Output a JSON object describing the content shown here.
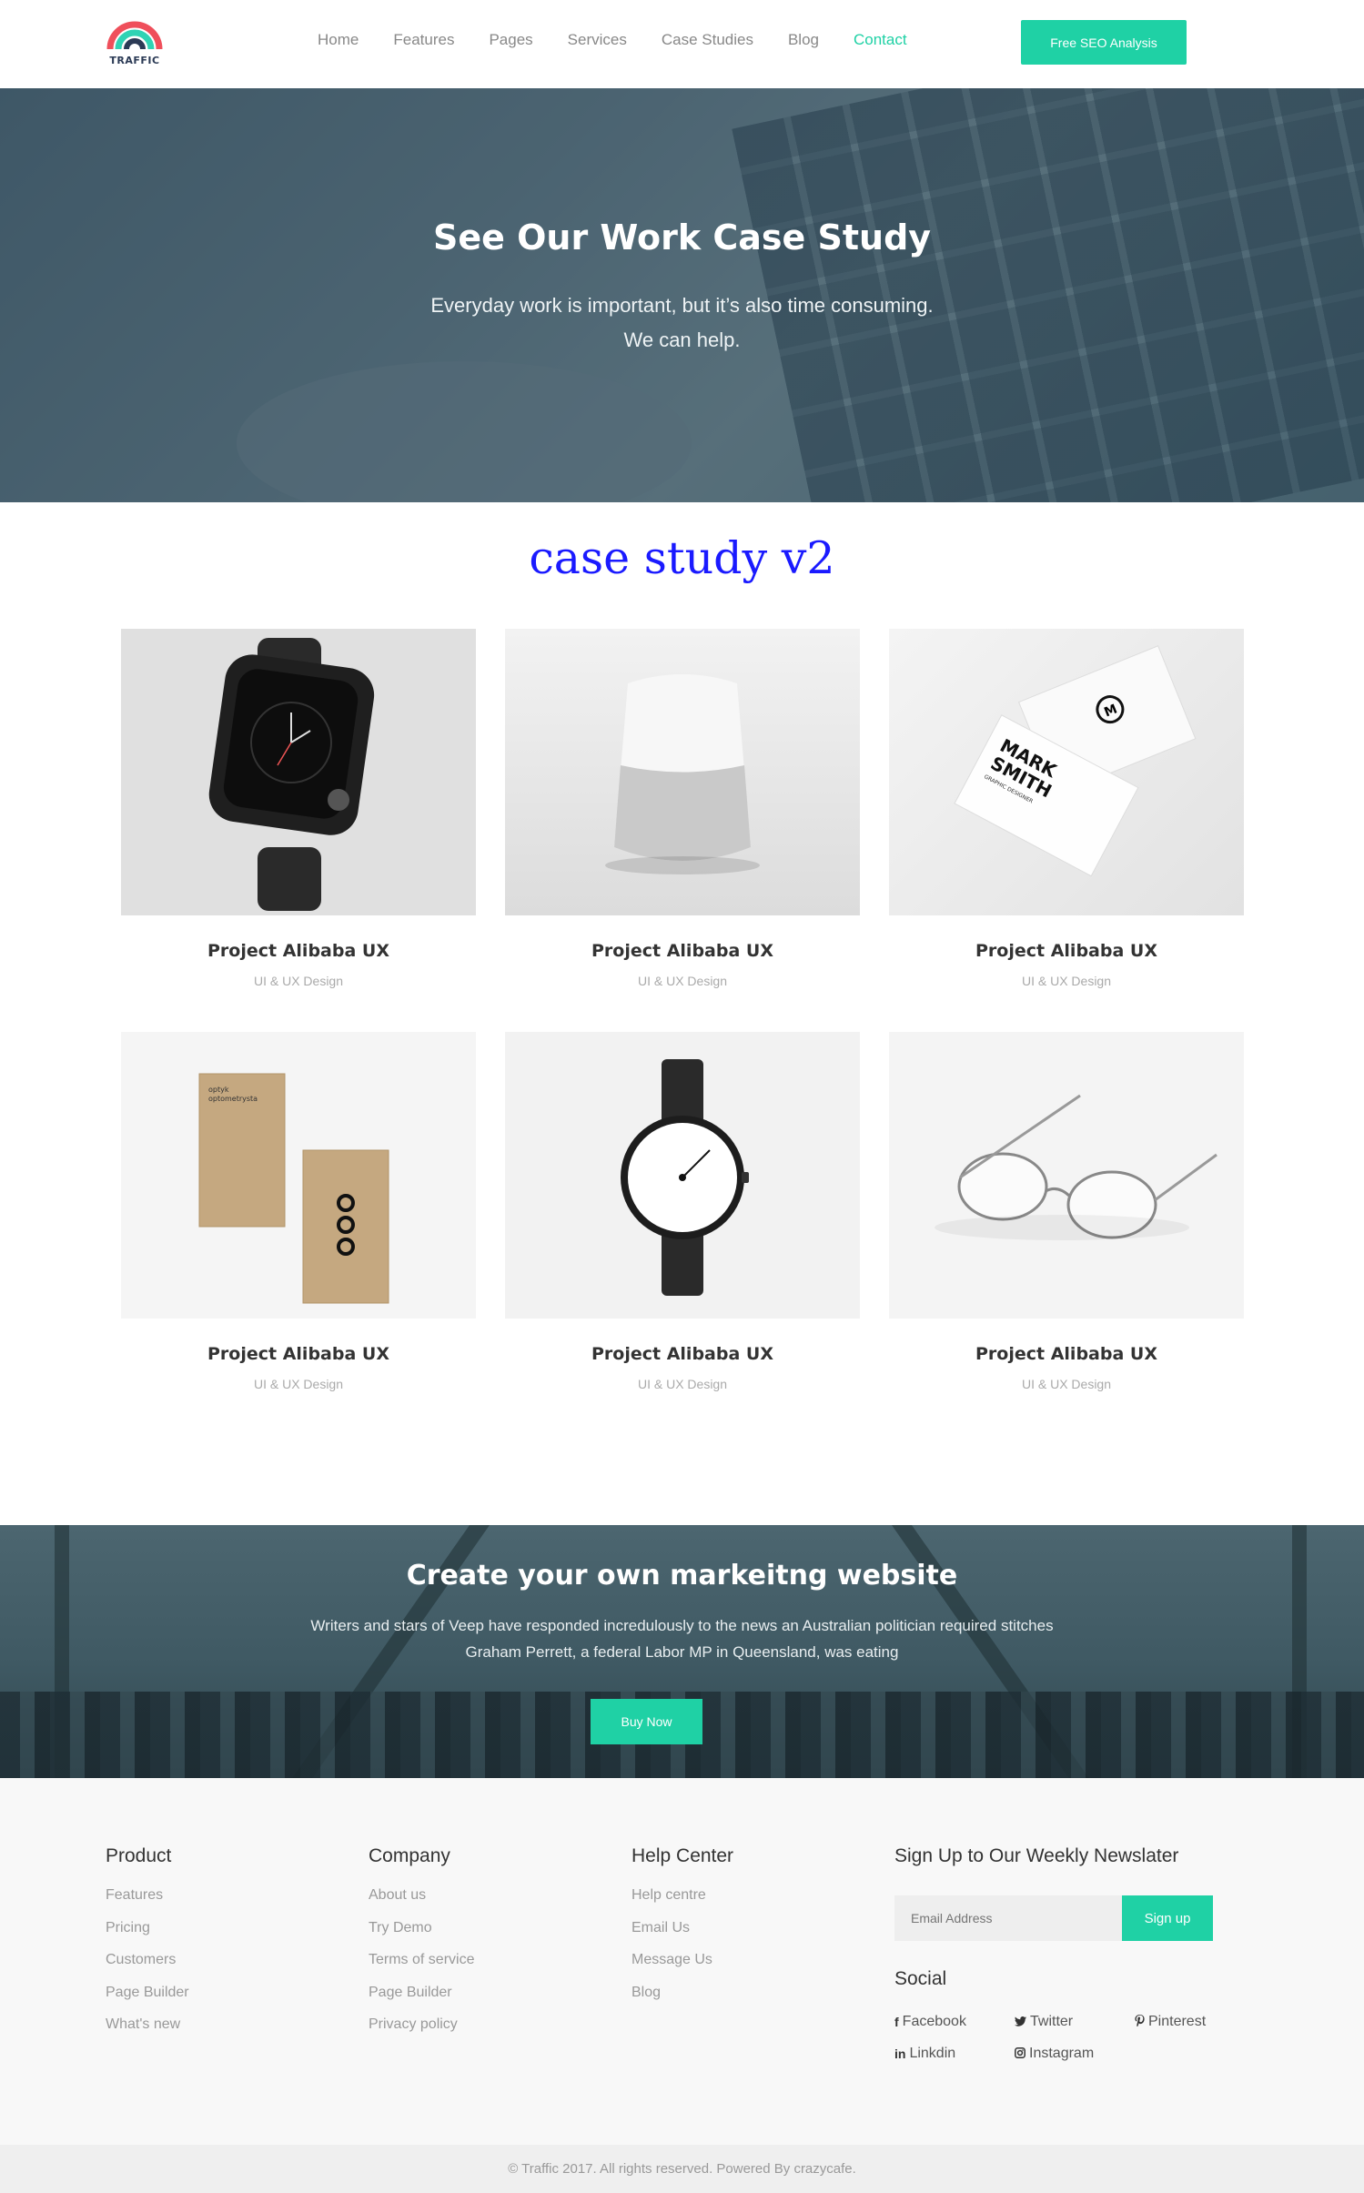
{
  "brand": {
    "name": "TRAFFIC",
    "colors": {
      "accent": "#1fd1a5",
      "logo_red": "#ef4f5b",
      "logo_teal": "#2fd3b4",
      "logo_navy": "#2b3a55"
    }
  },
  "nav": {
    "items": [
      {
        "label": "Home"
      },
      {
        "label": "Features"
      },
      {
        "label": "Pages"
      },
      {
        "label": "Services"
      },
      {
        "label": "Case Studies"
      },
      {
        "label": "Blog"
      },
      {
        "label": "Contact",
        "active": true
      }
    ],
    "cta_label": "Free SEO Analysis"
  },
  "hero": {
    "title": "See Our Work Case Study",
    "line1": "Everyday work is important, but it’s also time consuming.",
    "line2": "We can help."
  },
  "section_title": "case study v2",
  "projects": [
    {
      "title": "Project Alibaba UX",
      "category": "UI & UX Design",
      "icon": "smartwatch-image"
    },
    {
      "title": "Project Alibaba UX",
      "category": "UI & UX Design",
      "icon": "smart-speaker-image"
    },
    {
      "title": "Project Alibaba UX",
      "category": "UI & UX Design",
      "icon": "business-card-image",
      "card_text": {
        "monogram": "M",
        "name_line1": "MARK",
        "name_line2": "SMITH",
        "role": "GRAPHIC DESIGNER"
      }
    },
    {
      "title": "Project Alibaba UX",
      "category": "UI & UX Design",
      "icon": "kraft-card-image",
      "card_text": {
        "line1": "optyk",
        "line2": "optometrysta"
      }
    },
    {
      "title": "Project Alibaba UX",
      "category": "UI & UX Design",
      "icon": "wristwatch-image"
    },
    {
      "title": "Project Alibaba UX",
      "category": "UI & UX Design",
      "icon": "glasses-image"
    }
  ],
  "band": {
    "title": "Create your own markeitng website",
    "line1": "Writers and stars of Veep have responded incredulously to the news an Australian politician required stitches",
    "line2": "Graham Perrett, a federal Labor MP in Queensland, was eating",
    "button": "Buy Now"
  },
  "footer": {
    "product": {
      "heading": "Product",
      "links": [
        "Features",
        "Pricing",
        "Customers",
        "Page Builder",
        "What's new"
      ]
    },
    "company": {
      "heading": "Company",
      "links": [
        "About us",
        "Try Demo",
        "Terms of service",
        "Page Builder",
        "Privacy policy"
      ]
    },
    "help": {
      "heading": "Help Center",
      "links": [
        "Help centre",
        "Email Us",
        "Message Us",
        "Blog"
      ]
    },
    "newsletter": {
      "heading": "Sign Up to Our Weekly Newslater",
      "placeholder": "Email Address",
      "button": "Sign up"
    },
    "social": {
      "heading": "Social",
      "items": [
        {
          "label": "Facebook",
          "icon": "facebook-icon",
          "glyph": "f"
        },
        {
          "label": "Twitter",
          "icon": "twitter-icon",
          "glyph": "🐦"
        },
        {
          "label": "Pinterest",
          "icon": "pinterest-icon",
          "glyph": "𝒑"
        },
        {
          "label": "Linkdin",
          "icon": "linkedin-icon",
          "glyph": "in"
        },
        {
          "label": "Instagram",
          "icon": "instagram-icon",
          "glyph": "◙"
        }
      ]
    }
  },
  "copyright": "© Traffic 2017. All rights reserved. Powered By crazycafe."
}
